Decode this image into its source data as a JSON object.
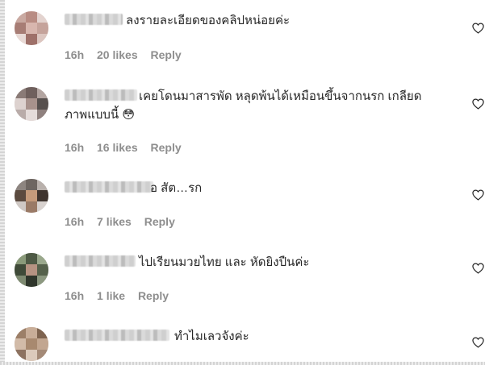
{
  "comments": [
    {
      "text": "ลงรายละเอียดของคลิปหน่อยค่ะ",
      "time": "16h",
      "likes": "20 likes",
      "reply": "Reply"
    },
    {
      "text": "เคยโดนมาสารพัด หลุดพ้นได้เหมือนขึ้นจากนรก เกลียด",
      "text2": "ภาพแบบนี้ 😳",
      "time": "16h",
      "likes": "16 likes",
      "reply": "Reply"
    },
    {
      "text": "อ สัต…รก",
      "time": "16h",
      "likes": "7 likes",
      "reply": "Reply"
    },
    {
      "text": "ไปเรียนมวยไทย และ หัดยิงปืนค่ะ",
      "time": "16h",
      "likes": "1 like",
      "reply": "Reply"
    },
    {
      "text": "ทำไมเลวจังค่ะ"
    }
  ],
  "icons": {
    "like": "heart-outline-icon"
  },
  "colors": {
    "text": "#262626",
    "meta": "#8e8e8e"
  }
}
